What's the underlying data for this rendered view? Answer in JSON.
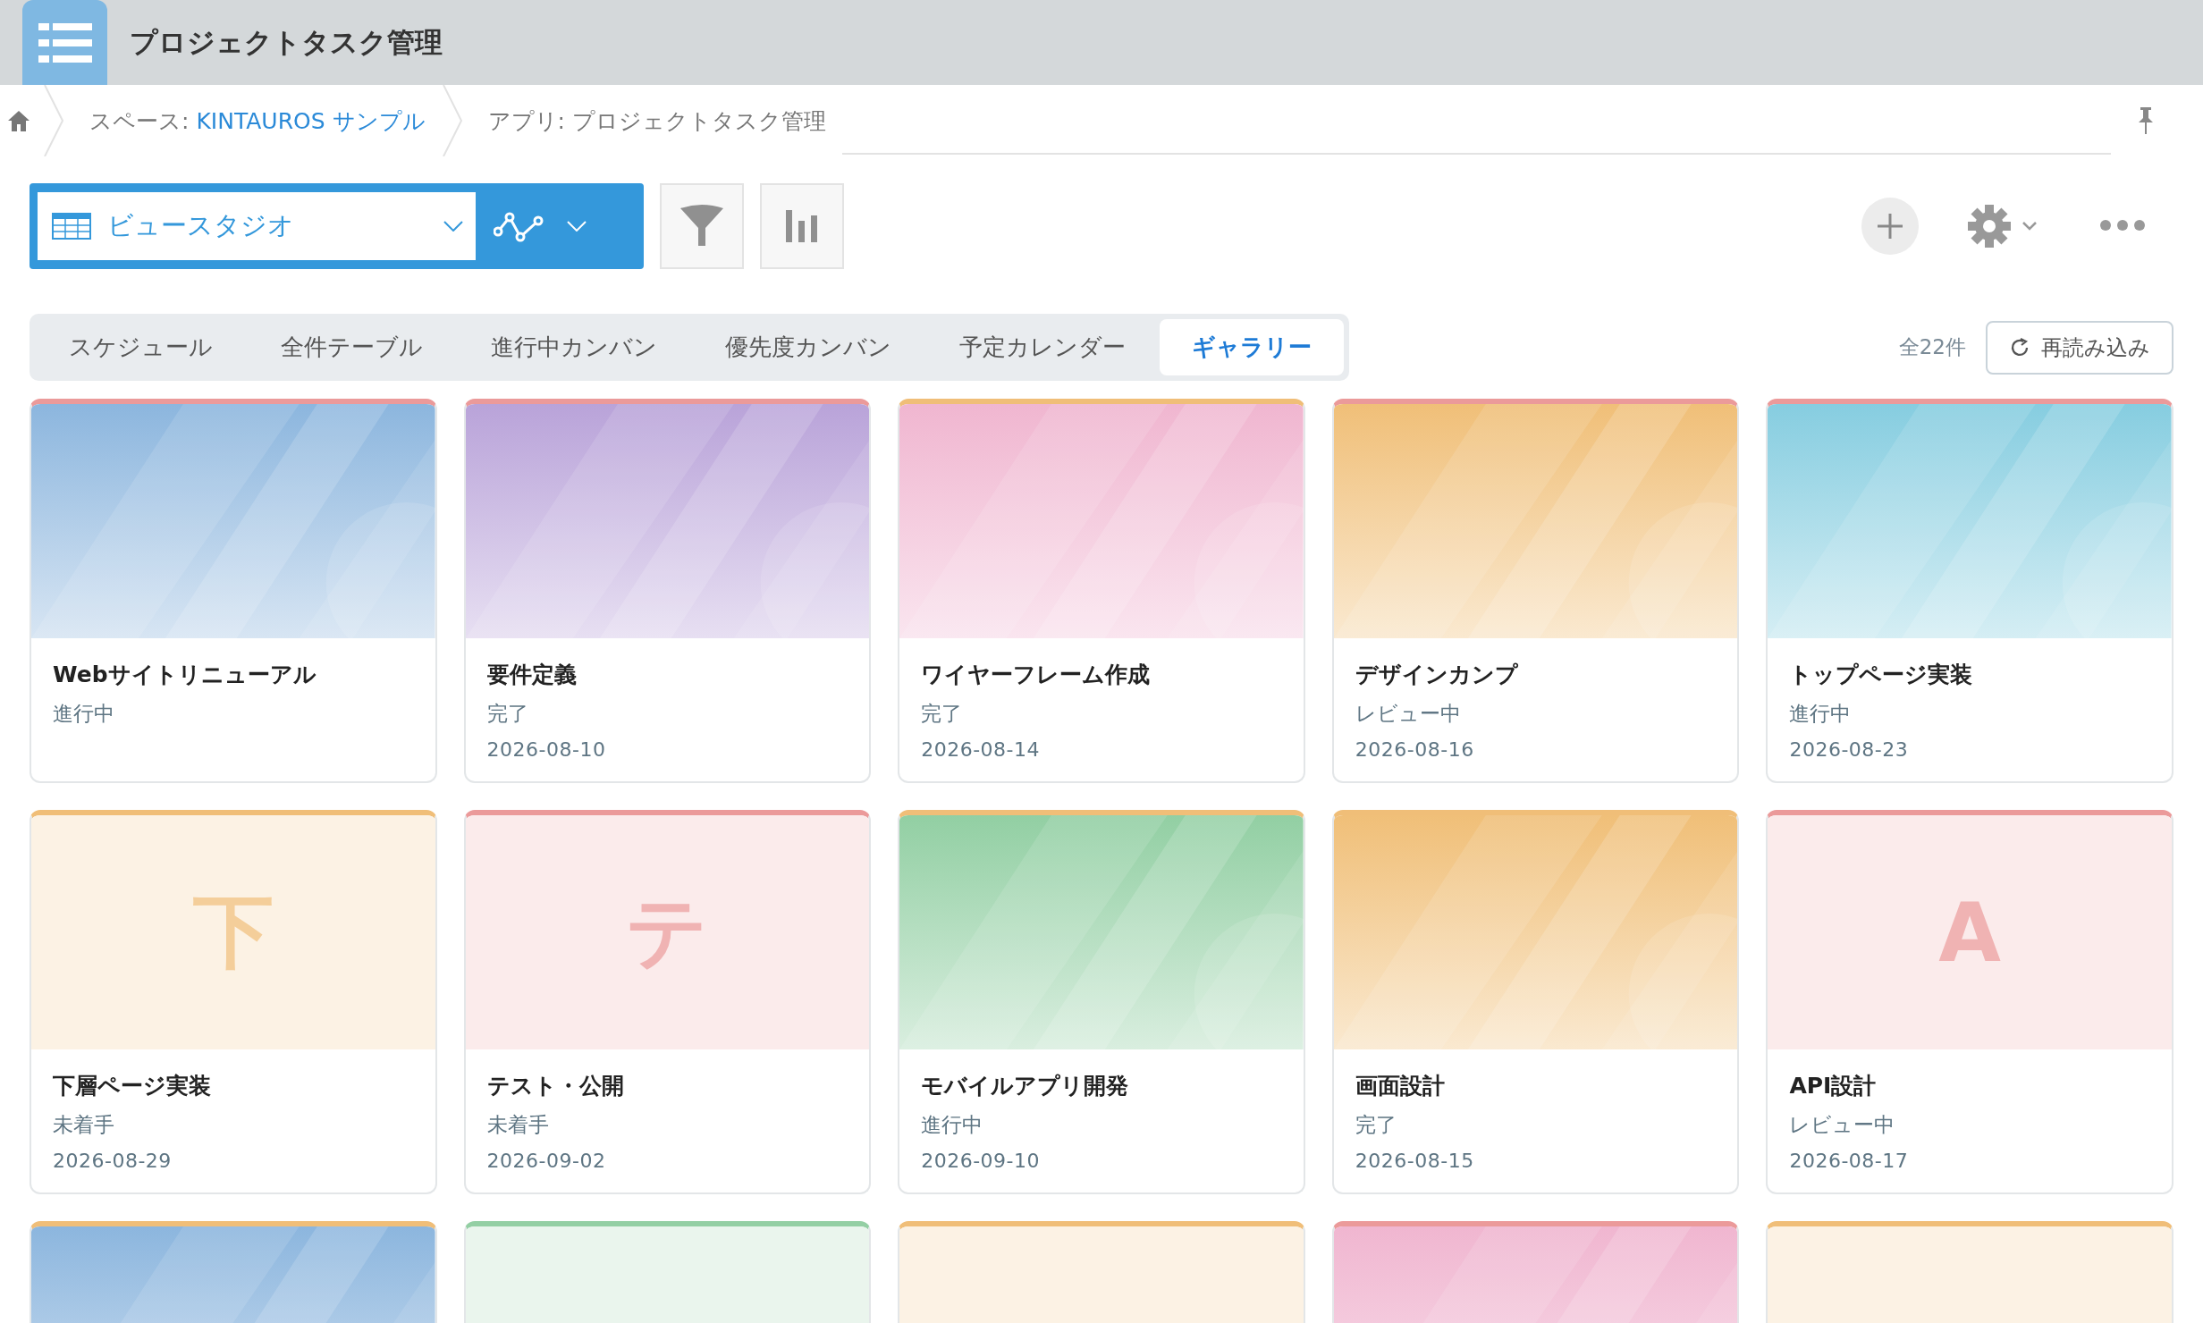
{
  "app": {
    "title": "プロジェクトタスク管理"
  },
  "breadcrumb": {
    "space_label": "スペース:",
    "space_link": "KINTAUROS サンプル",
    "app": "アプリ: プロジェクトタスク管理"
  },
  "view_selector": {
    "label": "ビュースタジオ"
  },
  "tabs": [
    {
      "label": "スケジュール",
      "selected": false
    },
    {
      "label": "全件テーブル",
      "selected": false
    },
    {
      "label": "進行中カンバン",
      "selected": false
    },
    {
      "label": "優先度カンバン",
      "selected": false
    },
    {
      "label": "予定カレンダー",
      "selected": false
    },
    {
      "label": "ギャラリー",
      "selected": true
    }
  ],
  "count": "全22件",
  "reload_button": "再読み込み",
  "cards": [
    {
      "color": "#eb9a9a",
      "thumb": {
        "kind": "gradient",
        "color": "#8cb6de"
      },
      "title": "Webサイトリニューアル",
      "status": "進行中"
    },
    {
      "color": "#eb9a9a",
      "thumb": {
        "kind": "gradient",
        "color": "#b9a3d9"
      },
      "title": "要件定義",
      "status": "完了",
      "date": "2026-08-10"
    },
    {
      "color": "#f0be78",
      "thumb": {
        "kind": "gradient",
        "color": "#f0b6d0"
      },
      "title": "ワイヤーフレーム作成",
      "status": "完了",
      "date": "2026-08-14"
    },
    {
      "color": "#eb9a9a",
      "thumb": {
        "kind": "gradient",
        "color": "#f0bf78"
      },
      "title": "デザインカンプ",
      "status": "レビュー中",
      "date": "2026-08-16"
    },
    {
      "color": "#eb9a9a",
      "thumb": {
        "kind": "gradient",
        "color": "#86cde0"
      },
      "title": "トップページ実装",
      "status": "進行中",
      "date": "2026-08-23"
    },
    {
      "color": "#f0be78",
      "thumb": {
        "kind": "letter",
        "letter": "下"
      },
      "title": "下層ページ実装",
      "status": "未着手",
      "date": "2026-08-29"
    },
    {
      "color": "#eb9a9a",
      "thumb": {
        "kind": "letter",
        "letter": "テ"
      },
      "title": "テスト・公開",
      "status": "未着手",
      "date": "2026-09-02"
    },
    {
      "color": "#f0be78",
      "thumb": {
        "kind": "gradient",
        "color": "#92cfa3"
      },
      "title": "モバイルアプリ開発",
      "status": "進行中",
      "date": "2026-09-10"
    },
    {
      "color": "#f0be78",
      "thumb": {
        "kind": "gradient",
        "color": "#f0bf78"
      },
      "title": "画面設計",
      "status": "完了",
      "date": "2026-08-15"
    },
    {
      "color": "#eb9a9a",
      "thumb": {
        "kind": "letter",
        "letter": "A"
      },
      "title": "API設計",
      "status": "レビュー中",
      "date": "2026-08-17"
    },
    {
      "color": "#f0be78",
      "thumb": {
        "kind": "gradient",
        "color": "#8cb6de"
      }
    },
    {
      "color": "#94cfa4",
      "thumb": {
        "kind": "letter"
      }
    },
    {
      "color": "#f0be78",
      "thumb": {
        "kind": "letter"
      }
    },
    {
      "color": "#eb9a9a",
      "thumb": {
        "kind": "gradient",
        "color": "#f0b6d0"
      }
    },
    {
      "color": "#f0be78",
      "thumb": {
        "kind": "letter"
      }
    }
  ]
}
